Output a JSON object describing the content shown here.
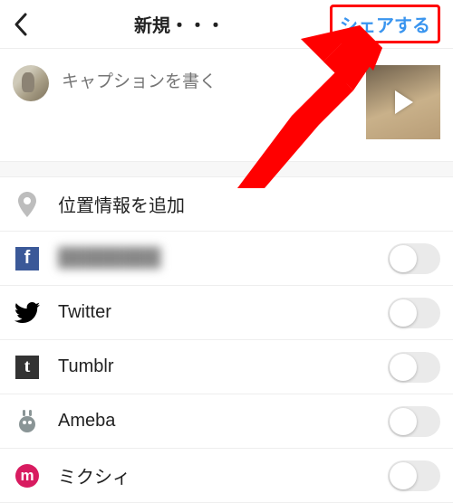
{
  "header": {
    "title": "新規・・・",
    "share_label": "シェアする"
  },
  "caption": {
    "placeholder": "キャプションを書く"
  },
  "location": {
    "label": "位置情報を追加"
  },
  "share_targets": [
    {
      "id": "facebook",
      "label": "████████",
      "blurred": true,
      "toggled": false
    },
    {
      "id": "twitter",
      "label": "Twitter",
      "blurred": false,
      "toggled": false
    },
    {
      "id": "tumblr",
      "label": "Tumblr",
      "blurred": false,
      "toggled": false
    },
    {
      "id": "ameba",
      "label": "Ameba",
      "blurred": false,
      "toggled": false
    },
    {
      "id": "mixi",
      "label": "ミクシィ",
      "blurred": false,
      "toggled": false
    }
  ],
  "annotation": {
    "share_highlight_color": "#ff0000"
  }
}
